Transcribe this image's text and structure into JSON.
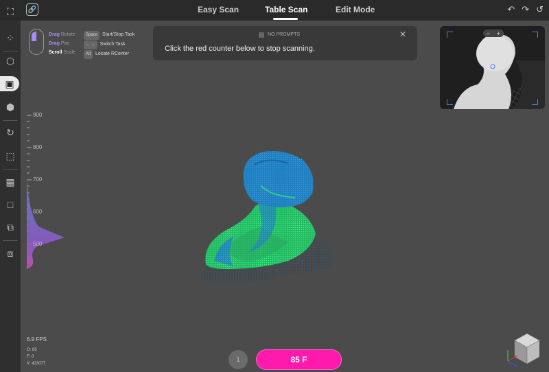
{
  "tabs": [
    {
      "label": "Easy Scan"
    },
    {
      "label": "Table Scan"
    },
    {
      "label": "Edit Mode"
    }
  ],
  "controls": {
    "rows": [
      {
        "action": "Drag",
        "desc": "Rotate"
      },
      {
        "action": "Drag",
        "desc": "Pan"
      },
      {
        "action": "Scroll",
        "desc": "Scale"
      }
    ],
    "keys": [
      {
        "key": "Space",
        "desc": "Start/Stop Task"
      },
      {
        "key": "← →",
        "desc": "Switch Task"
      },
      {
        "key": "Alt",
        "desc": "Locate RCenter"
      }
    ]
  },
  "prompt": {
    "checkbox_label": "NO PROMPTS",
    "message": "Click the red counter below to stop scanning.",
    "close": "✕"
  },
  "ruler": {
    "labels": [
      "900",
      "800",
      "700",
      "600",
      "500"
    ]
  },
  "stats": {
    "fps": "6.9 FPS",
    "o": "O: 85",
    "f": "F: 0",
    "v": "V: 423077"
  },
  "bottom": {
    "counter": "1",
    "scan_button": "85 F"
  },
  "preview": {
    "zoom_minus": "−",
    "zoom_plus": "+"
  },
  "colors": {
    "accent": "#a78bfa",
    "scan_button": "#ff19ac",
    "scan_blue": "#1f7fc0",
    "scan_green": "#2fe07a"
  }
}
